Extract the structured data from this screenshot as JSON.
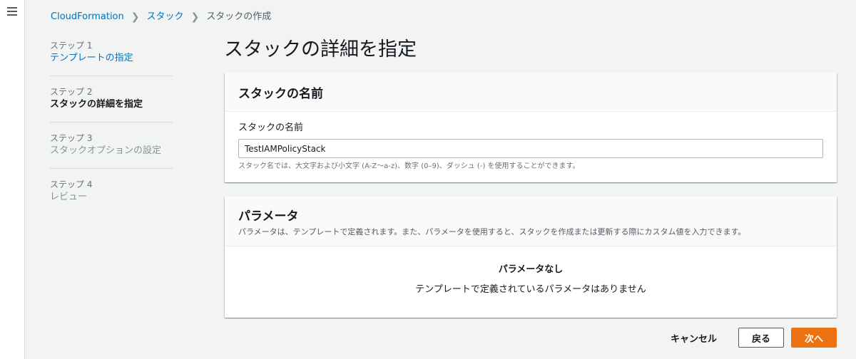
{
  "breadcrumb": {
    "items": [
      "CloudFormation",
      "スタック"
    ],
    "current": "スタックの作成"
  },
  "steps": [
    {
      "num": "ステップ 1",
      "label": "テンプレートの指定",
      "state": "link"
    },
    {
      "num": "ステップ 2",
      "label": "スタックの詳細を指定",
      "state": "active"
    },
    {
      "num": "ステップ 3",
      "label": "スタックオプションの設定",
      "state": "disabled"
    },
    {
      "num": "ステップ 4",
      "label": "レビュー",
      "state": "disabled"
    }
  ],
  "page_title": "スタックの詳細を指定",
  "stack_name_panel": {
    "title": "スタックの名前",
    "field_label": "スタックの名前",
    "field_value": "TestIAMPolicyStack",
    "hint": "スタック名では、大文字および小文字 (A-Z〜a-z)、数字 (0–9)、ダッシュ (-) を使用することができます。"
  },
  "parameters_panel": {
    "title": "パラメータ",
    "description": "パラメータは、テンプレートで定義されます。また、パラメータを使用すると、スタックを作成または更新する際にカスタム値を入力できます。",
    "empty_title": "パラメータなし",
    "empty_desc": "テンプレートで定義されているパラメータはありません"
  },
  "actions": {
    "cancel": "キャンセル",
    "back": "戻る",
    "next": "次へ"
  },
  "colors": {
    "link": "#0073bb",
    "primary": "#ec7211",
    "background": "#f2f3f3"
  },
  "icons": {
    "menu": "hamburger-menu-icon",
    "breadcrumb_separator": "chevron-right-icon"
  }
}
